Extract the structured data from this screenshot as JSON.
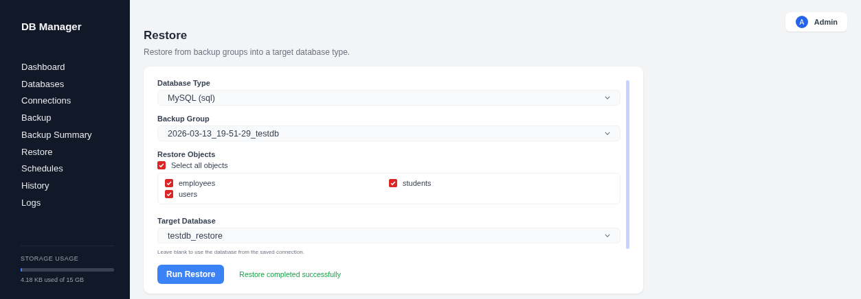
{
  "sidebar": {
    "brand": "DB Manager",
    "items": [
      {
        "label": "Dashboard",
        "selected": false
      },
      {
        "label": "Databases",
        "selected": false
      },
      {
        "label": "Connections",
        "selected": false
      },
      {
        "label": "Backup",
        "selected": false
      },
      {
        "label": "Backup Summary",
        "selected": false
      },
      {
        "label": "Restore",
        "selected": false
      },
      {
        "label": "Schedules",
        "selected": false
      },
      {
        "label": "History",
        "selected": false
      },
      {
        "label": "Logs",
        "selected": false
      }
    ],
    "storage": {
      "title": "STORAGE USAGE",
      "level": 0.01,
      "reading": "4.18 KB used of 15 GB"
    }
  },
  "user": {
    "initial": "A",
    "name": "Admin"
  },
  "page": {
    "title": "Restore",
    "subtitle": "Restore from backup groups into a target database type."
  },
  "form": {
    "database_type": {
      "label": "Database Type",
      "value": "MySQL (sql)"
    },
    "backup_group": {
      "label": "Backup Group",
      "value": "2026-03-13_19-51-29_testdb"
    },
    "restore_objects": {
      "label": "Restore Objects",
      "select_all": {
        "label": "Select all objects",
        "checked": true
      },
      "objects": [
        {
          "label": "employees",
          "checked": true
        },
        {
          "label": "students",
          "checked": true
        },
        {
          "label": "users",
          "checked": true
        }
      ]
    },
    "target_database": {
      "label": "Target Database",
      "value": "testdb_restore",
      "hint": "Leave blank to use the database from the saved connection."
    },
    "run_button": "Run Restore",
    "status": "Restore completed successfully"
  }
}
